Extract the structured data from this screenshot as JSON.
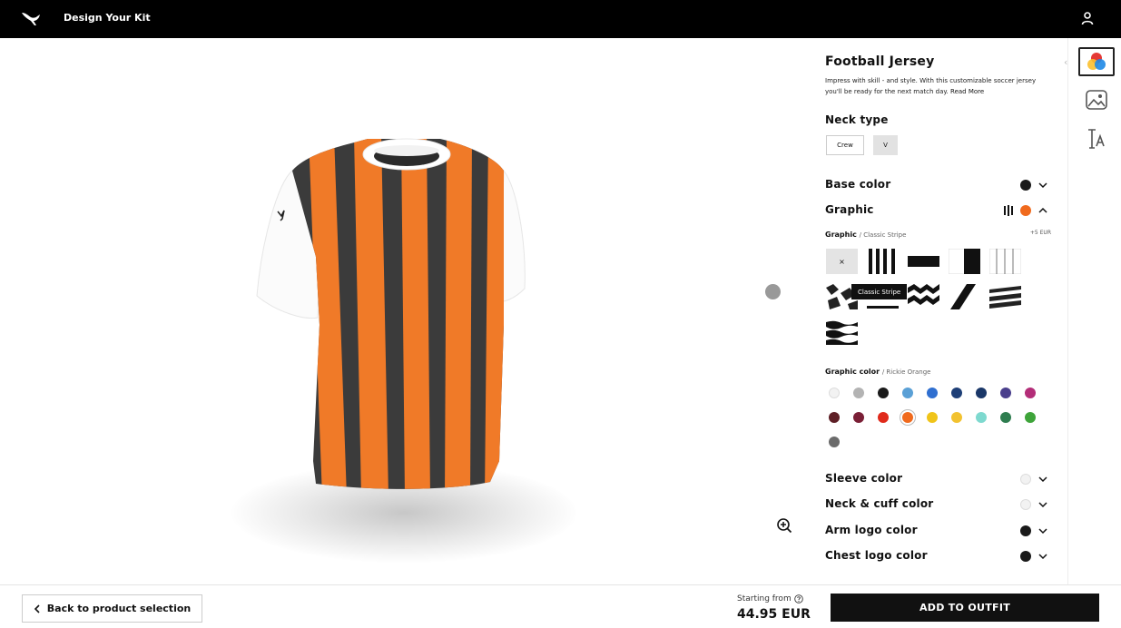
{
  "app": {
    "title": "Design Your Kit"
  },
  "product": {
    "title": "Football Jersey",
    "description": "Impress with skill - and style. With this customizable soccer jersey you'll be ready for the next match day.",
    "read_more": "Read More"
  },
  "neck": {
    "label": "Neck type",
    "options": [
      "Crew",
      "V"
    ],
    "selected": "V"
  },
  "sections": {
    "base_color": {
      "label": "Base color",
      "color": "#1a1a1a"
    },
    "graphic": {
      "label": "Graphic",
      "color": "#f06a1d",
      "expanded": true
    },
    "sleeve_color": {
      "label": "Sleeve color",
      "color": "#f2f2f2"
    },
    "neck_cuff_color": {
      "label": "Neck & cuff color",
      "color": "#f2f2f2"
    },
    "arm_logo_color": {
      "label": "Arm logo color",
      "color": "#1a1a1a"
    },
    "chest_logo_color": {
      "label": "Chest logo color",
      "color": "#1a1a1a"
    }
  },
  "graphic_picker": {
    "label": "Graphic",
    "selected_name": "/ Classic Stripe",
    "price_add": "+5 EUR",
    "none_label": "×",
    "tooltip": "Classic Stripe"
  },
  "graphic_color": {
    "label": "Graphic color",
    "selected_name": "/ Rickie Orange",
    "swatches": [
      "#f2f2f2",
      "#b3b3b3",
      "#1a1a1a",
      "#5aa0d6",
      "#2f6fd0",
      "#1e3f77",
      "#1a3768",
      "#4a3f8c",
      "#b32d78",
      "#5e1f26",
      "#7a1f36",
      "#e02a1b",
      "#f06a1d",
      "#f0c419",
      "#f2c230",
      "#7ed9cf",
      "#2e7d4f",
      "#3ea43a",
      "#6b6b6b"
    ],
    "selected_index": 12
  },
  "footer": {
    "back_label": "Back to product selection",
    "starting_from": "Starting from",
    "price": "44.95 EUR",
    "add_label": "ADD TO OUTFIT"
  }
}
